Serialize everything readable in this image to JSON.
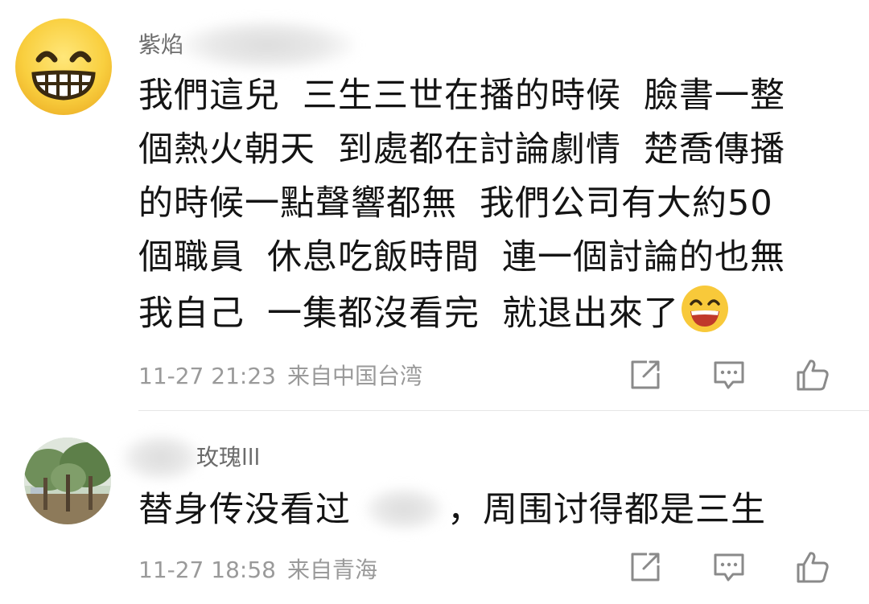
{
  "comments": [
    {
      "username": "紫焰",
      "avatar_icon": "grinning-emoji-avatar",
      "content_lines": [
        [
          "我們這兒",
          "三生三世在播的時候",
          "臉書一整"
        ],
        [
          "個熱火朝天",
          "到處都在討論劇情",
          "楚喬傳播"
        ],
        [
          "的時候一點聲響都無",
          "我們公司有大約50"
        ],
        [
          "個職員",
          "休息吃飯時間",
          "連一個討論的也無"
        ],
        [
          "我自己",
          "一集都沒看完",
          "就退出來了"
        ]
      ],
      "trailing_emoji": "laughing-emoji",
      "timestamp": "11-27 21:23",
      "location": "来自中国台湾"
    },
    {
      "username": "玫瑰lll",
      "avatar_icon": "tree-photo-avatar",
      "content": "替身传没看过",
      "content_after_redaction": "，周围讨得都是三生",
      "timestamp": "11-27 18:58",
      "location": "来自青海"
    }
  ],
  "actions": {
    "share_icon": "share-icon",
    "reply_icon": "reply-icon",
    "like_icon": "like-icon"
  },
  "colors": {
    "text": "#141414",
    "meta": "#9a9a9a",
    "icon": "#8a8a8a",
    "emoji_yellow": "#f8c93a"
  }
}
